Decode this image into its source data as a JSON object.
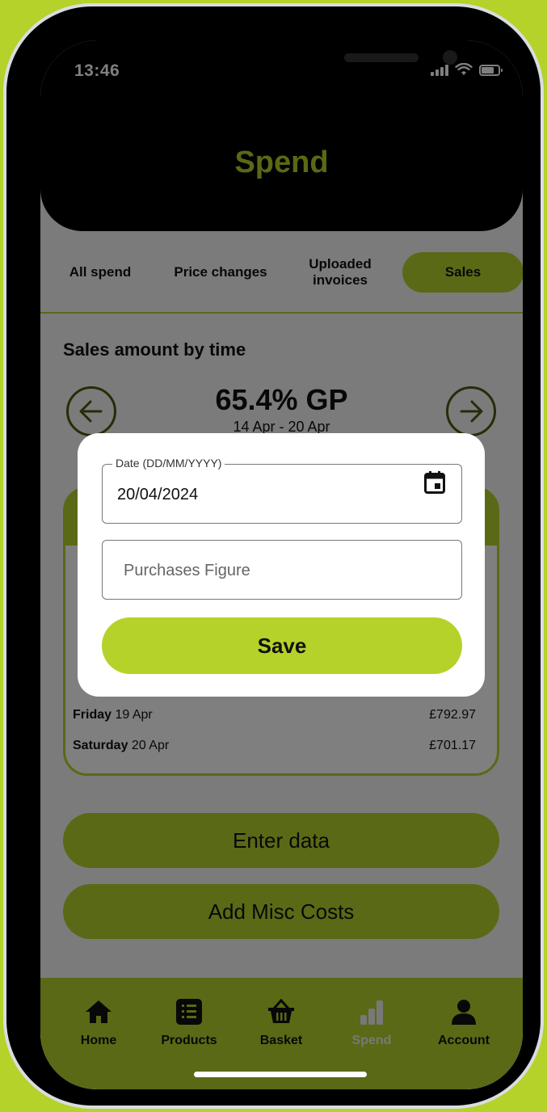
{
  "status_bar": {
    "time": "13:46"
  },
  "header": {
    "title": "Spend"
  },
  "tabs": [
    {
      "label": "All spend"
    },
    {
      "label": "Price changes"
    },
    {
      "label": "Uploaded invoices"
    },
    {
      "label": "Sales",
      "active": true
    }
  ],
  "sales": {
    "section_title": "Sales amount by time",
    "gp_label": "65.4% GP",
    "date_range": "14 Apr - 20 Apr",
    "rows": [
      {
        "day": "Friday",
        "date": "19 Apr",
        "amount": "£792.97"
      },
      {
        "day": "Saturday",
        "date": "20 Apr",
        "amount": "£701.17"
      }
    ]
  },
  "actions": {
    "enter_data": "Enter data",
    "add_misc_costs": "Add Misc Costs"
  },
  "dialog": {
    "date_label": "Date (DD/MM/YYYY)",
    "date_value": "20/04/2024",
    "purchases_placeholder": "Purchases Figure",
    "save_label": "Save"
  },
  "nav": [
    {
      "label": "Home",
      "icon": "home-icon"
    },
    {
      "label": "Products",
      "icon": "list-icon"
    },
    {
      "label": "Basket",
      "icon": "basket-icon"
    },
    {
      "label": "Spend",
      "icon": "bar-chart-icon",
      "active": true
    },
    {
      "label": "Account",
      "icon": "person-icon"
    }
  ],
  "colors": {
    "accent": "#b5d22a",
    "header": "#000000",
    "background": "#b5d22a"
  }
}
